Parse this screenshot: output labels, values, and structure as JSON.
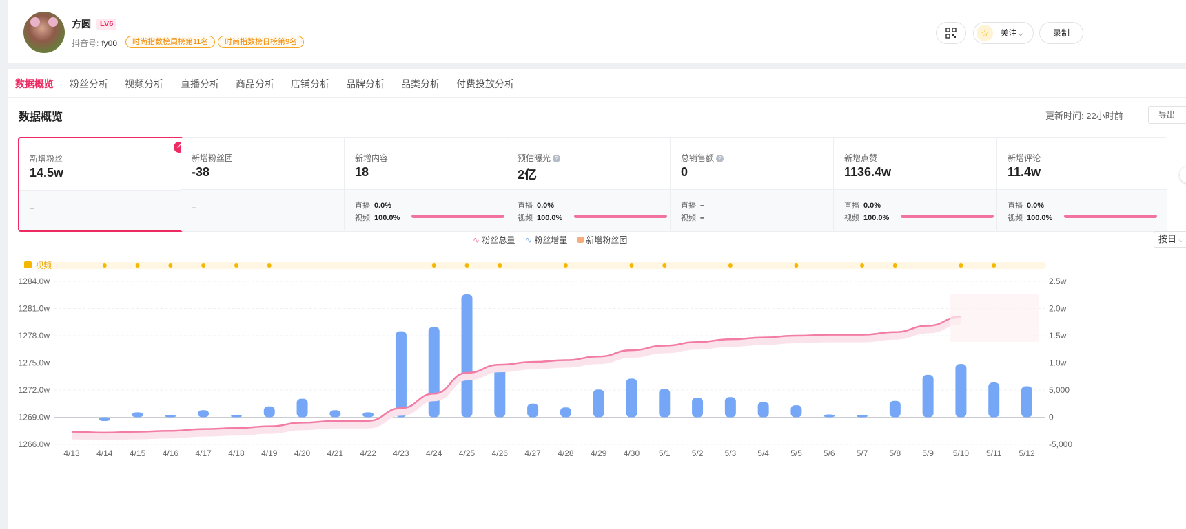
{
  "profile": {
    "name": "方圆",
    "level": "LV6",
    "account_label": "抖音号:",
    "account_id": "fy00",
    "tags": [
      "时尚指数榜周榜第11名",
      "时尚指数榜日榜第9名"
    ],
    "follow_label": "关注",
    "record_label": "录制"
  },
  "tabs": [
    "数据概览",
    "粉丝分析",
    "视频分析",
    "直播分析",
    "商品分析",
    "店铺分析",
    "品牌分析",
    "品类分析",
    "付费投放分析"
  ],
  "overview": {
    "title": "数据概览",
    "updated_label": "更新时间:",
    "updated_value": "22小时前",
    "export_label": "导出"
  },
  "row_labels": {
    "live": "直播",
    "video": "视频"
  },
  "cards": [
    {
      "label": "新增粉丝",
      "value": "14.5w",
      "selected": true,
      "help": false,
      "dash": "–"
    },
    {
      "label": "新增粉丝团",
      "value": "-38",
      "selected": false,
      "help": false,
      "dash": "–"
    },
    {
      "label": "新增内容",
      "value": "18",
      "help": false,
      "live": "0.0%",
      "video": "100.0%",
      "video_share": 1.0
    },
    {
      "label": "预估曝光",
      "value": "2亿",
      "help": true,
      "live": "0.0%",
      "video": "100.0%",
      "video_share": 1.0
    },
    {
      "label": "总销售额",
      "value": "0",
      "help": true,
      "live": "–",
      "video": "–"
    },
    {
      "label": "新增点赞",
      "value": "1136.4w",
      "help": false,
      "live": "0.0%",
      "video": "100.0%",
      "video_share": 1.0
    },
    {
      "label": "新增评论",
      "value": "11.4w",
      "help": false,
      "live": "0.0%",
      "video": "100.0%",
      "video_share": 1.0
    }
  ],
  "colors": {
    "accent": "#ee2a63",
    "line": "#f27ca4",
    "bar": "#76a7f7",
    "fan_club": "#f6ad7b",
    "video_dot": "#f5b800"
  },
  "chart_data": {
    "type": "bar",
    "legend": [
      {
        "name": "粉丝总量",
        "kind": "line"
      },
      {
        "name": "粉丝增量",
        "kind": "line"
      },
      {
        "name": "新增粉丝团",
        "kind": "square"
      }
    ],
    "period": "按日",
    "video_row_label": "视频",
    "categories": [
      "4/13",
      "4/14",
      "4/15",
      "4/16",
      "4/17",
      "4/18",
      "4/19",
      "4/20",
      "4/21",
      "4/22",
      "4/23",
      "4/24",
      "4/25",
      "4/26",
      "4/27",
      "4/28",
      "4/29",
      "4/30",
      "5/1",
      "5/2",
      "5/3",
      "5/4",
      "5/5",
      "5/6",
      "5/7",
      "5/8",
      "5/9",
      "5/10",
      "5/11",
      "5/12"
    ],
    "y_left": {
      "min": 1266.0,
      "max": 1284.0,
      "ticks": [
        "1284.0w",
        "1281.0w",
        "1278.0w",
        "1275.0w",
        "1272.0w",
        "1269.0w",
        "1266.0w"
      ]
    },
    "y_right": {
      "min": -5000,
      "max": 25000,
      "ticks": [
        "2.5w",
        "2.0w",
        "1.5w",
        "1.0w",
        "5,000",
        "0",
        "-5,000"
      ]
    },
    "series": [
      {
        "name": "粉丝增量",
        "values": [
          null,
          -700,
          900,
          400,
          1300,
          400,
          2000,
          3400,
          1300,
          900,
          15800,
          16600,
          22600,
          9100,
          2500,
          1800,
          5100,
          7100,
          5200,
          3600,
          3700,
          2800,
          2200,
          500,
          400,
          3000,
          7800,
          9800,
          6400,
          5700
        ]
      },
      {
        "name": "粉丝总量",
        "values": [
          1267.4,
          1267.3,
          1267.4,
          1267.5,
          1267.7,
          1267.8,
          1268.0,
          1268.4,
          1268.6,
          1268.6,
          1270.0,
          1271.6,
          1273.9,
          1274.8,
          1275.1,
          1275.3,
          1275.7,
          1276.4,
          1276.9,
          1277.3,
          1277.6,
          1277.8,
          1278.0,
          1278.1,
          1278.1,
          1278.4,
          1279.1,
          1280.1,
          null,
          null
        ]
      }
    ],
    "video_days": [
      "4/14",
      "4/15",
      "4/16",
      "4/17",
      "4/18",
      "4/19",
      "4/24",
      "4/25",
      "4/26",
      "4/28",
      "4/30",
      "5/1",
      "5/3",
      "5/5",
      "5/7",
      "5/8",
      "5/10",
      "5/11"
    ]
  }
}
